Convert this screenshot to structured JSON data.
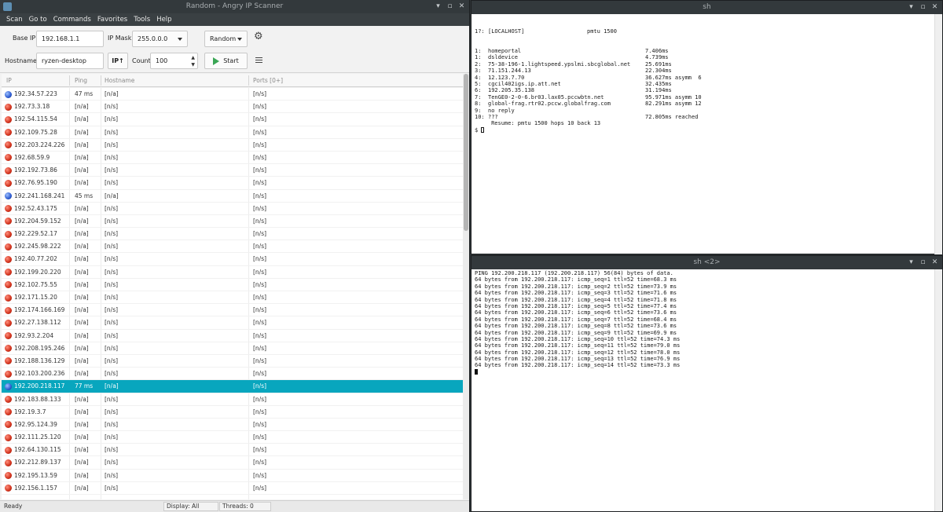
{
  "scanner": {
    "window_title": "Random - Angry IP Scanner",
    "menu": [
      "Scan",
      "Go to",
      "Commands",
      "Favorites",
      "Tools",
      "Help"
    ],
    "toolbar": {
      "base_ip_label": "Base IP:",
      "base_ip_value": "192.168.1.1",
      "ip_mask_label": "IP Mask:",
      "ip_mask_value": "255.0.0.0",
      "feeder_value": "Random",
      "hostname_label": "Hostname:",
      "hostname_value": "ryzen-desktop",
      "ip_up_label": "IP↑",
      "count_label": "Count",
      "count_value": "100",
      "start_label": "Start"
    },
    "columns": [
      "IP",
      "Ping",
      "Hostname",
      "Ports [0+]"
    ],
    "rows": [
      {
        "ip": "192.34.57.223",
        "ping": "47 ms",
        "host": "[n/a]",
        "ports": "[n/s]",
        "alive": true,
        "selected": false
      },
      {
        "ip": "192.73.3.18",
        "ping": "[n/a]",
        "host": "[n/s]",
        "ports": "[n/s]",
        "alive": false,
        "selected": false
      },
      {
        "ip": "192.54.115.54",
        "ping": "[n/a]",
        "host": "[n/s]",
        "ports": "[n/s]",
        "alive": false,
        "selected": false
      },
      {
        "ip": "192.109.75.28",
        "ping": "[n/a]",
        "host": "[n/s]",
        "ports": "[n/s]",
        "alive": false,
        "selected": false
      },
      {
        "ip": "192.203.224.226",
        "ping": "[n/a]",
        "host": "[n/s]",
        "ports": "[n/s]",
        "alive": false,
        "selected": false
      },
      {
        "ip": "192.68.59.9",
        "ping": "[n/a]",
        "host": "[n/s]",
        "ports": "[n/s]",
        "alive": false,
        "selected": false
      },
      {
        "ip": "192.192.73.86",
        "ping": "[n/a]",
        "host": "[n/s]",
        "ports": "[n/s]",
        "alive": false,
        "selected": false
      },
      {
        "ip": "192.76.95.190",
        "ping": "[n/a]",
        "host": "[n/s]",
        "ports": "[n/s]",
        "alive": false,
        "selected": false
      },
      {
        "ip": "192.241.168.241",
        "ping": "45 ms",
        "host": "[n/a]",
        "ports": "[n/s]",
        "alive": true,
        "selected": false
      },
      {
        "ip": "192.52.43.175",
        "ping": "[n/a]",
        "host": "[n/s]",
        "ports": "[n/s]",
        "alive": false,
        "selected": false
      },
      {
        "ip": "192.204.59.152",
        "ping": "[n/a]",
        "host": "[n/s]",
        "ports": "[n/s]",
        "alive": false,
        "selected": false
      },
      {
        "ip": "192.229.52.17",
        "ping": "[n/a]",
        "host": "[n/s]",
        "ports": "[n/s]",
        "alive": false,
        "selected": false
      },
      {
        "ip": "192.245.98.222",
        "ping": "[n/a]",
        "host": "[n/s]",
        "ports": "[n/s]",
        "alive": false,
        "selected": false
      },
      {
        "ip": "192.40.77.202",
        "ping": "[n/a]",
        "host": "[n/s]",
        "ports": "[n/s]",
        "alive": false,
        "selected": false
      },
      {
        "ip": "192.199.20.220",
        "ping": "[n/a]",
        "host": "[n/s]",
        "ports": "[n/s]",
        "alive": false,
        "selected": false
      },
      {
        "ip": "192.102.75.55",
        "ping": "[n/a]",
        "host": "[n/s]",
        "ports": "[n/s]",
        "alive": false,
        "selected": false
      },
      {
        "ip": "192.171.15.20",
        "ping": "[n/a]",
        "host": "[n/s]",
        "ports": "[n/s]",
        "alive": false,
        "selected": false
      },
      {
        "ip": "192.174.166.169",
        "ping": "[n/a]",
        "host": "[n/s]",
        "ports": "[n/s]",
        "alive": false,
        "selected": false
      },
      {
        "ip": "192.27.138.112",
        "ping": "[n/a]",
        "host": "[n/s]",
        "ports": "[n/s]",
        "alive": false,
        "selected": false
      },
      {
        "ip": "192.93.2.204",
        "ping": "[n/a]",
        "host": "[n/s]",
        "ports": "[n/s]",
        "alive": false,
        "selected": false
      },
      {
        "ip": "192.208.195.246",
        "ping": "[n/a]",
        "host": "[n/s]",
        "ports": "[n/s]",
        "alive": false,
        "selected": false
      },
      {
        "ip": "192.188.136.129",
        "ping": "[n/a]",
        "host": "[n/s]",
        "ports": "[n/s]",
        "alive": false,
        "selected": false
      },
      {
        "ip": "192.103.200.236",
        "ping": "[n/a]",
        "host": "[n/s]",
        "ports": "[n/s]",
        "alive": false,
        "selected": false
      },
      {
        "ip": "192.200.218.117",
        "ping": "77 ms",
        "host": "[n/a]",
        "ports": "[n/s]",
        "alive": true,
        "selected": true
      },
      {
        "ip": "192.183.88.133",
        "ping": "[n/a]",
        "host": "[n/s]",
        "ports": "[n/s]",
        "alive": false,
        "selected": false
      },
      {
        "ip": "192.19.3.7",
        "ping": "[n/a]",
        "host": "[n/s]",
        "ports": "[n/s]",
        "alive": false,
        "selected": false
      },
      {
        "ip": "192.95.124.39",
        "ping": "[n/a]",
        "host": "[n/s]",
        "ports": "[n/s]",
        "alive": false,
        "selected": false
      },
      {
        "ip": "192.111.25.120",
        "ping": "[n/a]",
        "host": "[n/s]",
        "ports": "[n/s]",
        "alive": false,
        "selected": false
      },
      {
        "ip": "192.64.130.115",
        "ping": "[n/a]",
        "host": "[n/s]",
        "ports": "[n/s]",
        "alive": false,
        "selected": false
      },
      {
        "ip": "192.212.89.137",
        "ping": "[n/a]",
        "host": "[n/s]",
        "ports": "[n/s]",
        "alive": false,
        "selected": false
      },
      {
        "ip": "192.195.13.59",
        "ping": "[n/a]",
        "host": "[n/s]",
        "ports": "[n/s]",
        "alive": false,
        "selected": false
      },
      {
        "ip": "192.156.1.157",
        "ping": "[n/a]",
        "host": "[n/s]",
        "ports": "[n/s]",
        "alive": false,
        "selected": false
      }
    ],
    "status": {
      "state": "Ready",
      "display": "Display: All",
      "threads": "Threads: 0"
    }
  },
  "term1": {
    "title": "sh",
    "header": {
      "hop": "1?:",
      "host": "[LOCALHOST]",
      "info": "pmtu 1500"
    },
    "hops": [
      {
        "hop": "1:",
        "host": "homeportal",
        "time": "7.406ms"
      },
      {
        "hop": "1:",
        "host": "dsldevice",
        "time": "4.739ms"
      },
      {
        "hop": "2:",
        "host": "75-38-196-1.lightspeed.ypslmi.sbcglobal.net",
        "time": "25.691ms"
      },
      {
        "hop": "3:",
        "host": "71.151.244.13",
        "time": "22.304ms"
      },
      {
        "hop": "4:",
        "host": "12.123.7.70",
        "time": "36.627ms asymm  6"
      },
      {
        "hop": "5:",
        "host": "cgcil402igs.ip.att.net",
        "time": "32.435ms"
      },
      {
        "hop": "6:",
        "host": "192.205.35.138",
        "time": "31.194ms"
      },
      {
        "hop": "7:",
        "host": "TenGE0-2-0-6.br03.lax05.pccwbtn.net",
        "time": "95.971ms asymm 10"
      },
      {
        "hop": "8:",
        "host": "global-frag.rtr02.pccw.globalfrag.com",
        "time": "82.291ms asymm 12"
      },
      {
        "hop": "9:",
        "host": "no reply",
        "time": ""
      },
      {
        "hop": "10:",
        "host": "???",
        "time": "72.805ms reached"
      }
    ],
    "resume": "     Resume: pmtu 1500 hops 10 back 13",
    "prompt": "$ "
  },
  "term2": {
    "title": "sh <2>",
    "lines": [
      "PING 192.200.218.117 (192.200.218.117) 56(84) bytes of data.",
      "64 bytes from 192.200.218.117: icmp_seq=1 ttl=52 time=68.3 ms",
      "64 bytes from 192.200.218.117: icmp_seq=2 ttl=52 time=73.9 ms",
      "64 bytes from 192.200.218.117: icmp_seq=3 ttl=52 time=71.6 ms",
      "64 bytes from 192.200.218.117: icmp_seq=4 ttl=52 time=71.8 ms",
      "64 bytes from 192.200.218.117: icmp_seq=5 ttl=52 time=77.4 ms",
      "64 bytes from 192.200.218.117: icmp_seq=6 ttl=52 time=73.6 ms",
      "64 bytes from 192.200.218.117: icmp_seq=7 ttl=52 time=68.4 ms",
      "64 bytes from 192.200.218.117: icmp_seq=8 ttl=52 time=73.6 ms",
      "64 bytes from 192.200.218.117: icmp_seq=9 ttl=52 time=69.9 ms",
      "64 bytes from 192.200.218.117: icmp_seq=10 ttl=52 time=74.3 ms",
      "64 bytes from 192.200.218.117: icmp_seq=11 ttl=52 time=79.0 ms",
      "64 bytes from 192.200.218.117: icmp_seq=12 ttl=52 time=78.0 ms",
      "64 bytes from 192.200.218.117: icmp_seq=13 ttl=52 time=76.9 ms",
      "64 bytes from 192.200.218.117: icmp_seq=14 ttl=52 time=73.3 ms"
    ]
  },
  "colors": {
    "selection": "#08a6be",
    "titlebar": "#33393c",
    "alive": "#2c5ad0",
    "dead": "#d0301a",
    "start_icon": "#3aa655"
  },
  "icons": {
    "window_controls": [
      "minimize-icon",
      "maximize-icon",
      "close-icon"
    ],
    "status_dead": "red-circle-icon",
    "status_alive": "blue-circle-icon"
  }
}
